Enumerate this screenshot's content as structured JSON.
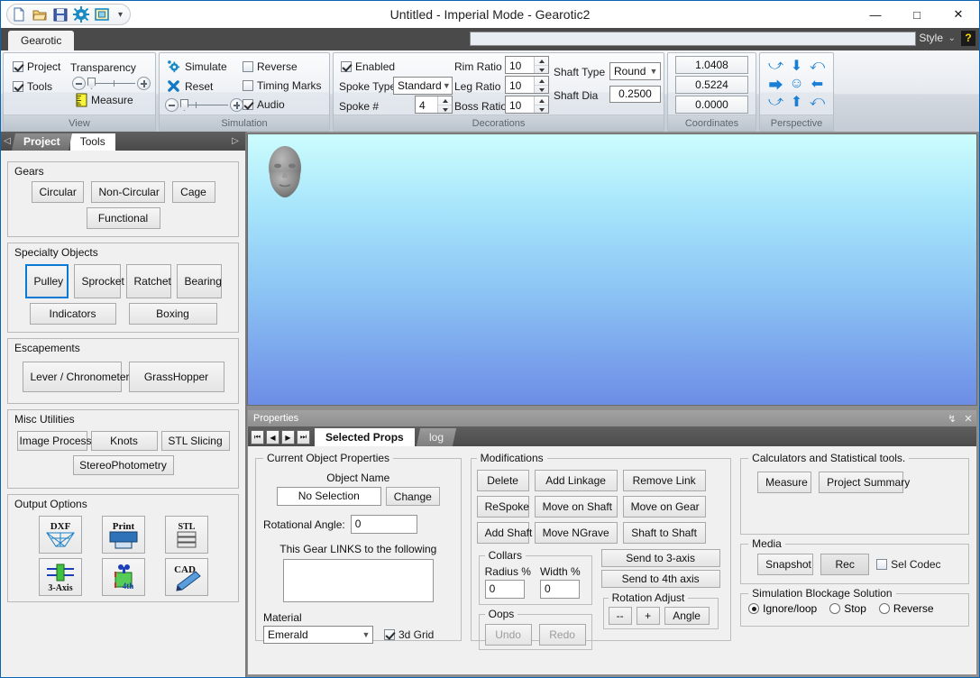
{
  "window": {
    "title": "Untitled -  Imperial Mode - Gearotic2",
    "minimize": "—",
    "maximize": "□",
    "close": "✕"
  },
  "quick_access": {
    "icons": [
      "new-document-icon",
      "open-folder-icon",
      "save-icon",
      "settings-gear-icon",
      "screen-capture-icon"
    ],
    "overflow": "▾"
  },
  "ribbon": {
    "tabs": [
      {
        "label": "Gearotic",
        "active": true
      }
    ],
    "search_placeholder": "",
    "style_label": "Style",
    "style_caret": "⌄",
    "help_label": "?",
    "groups": [
      {
        "name": "View",
        "label": "View",
        "checkboxes": [
          {
            "label": "Project",
            "checked": true
          },
          {
            "label": "Tools",
            "checked": true
          }
        ],
        "transparency_label": "Transparency",
        "measure_label": "Measure"
      },
      {
        "name": "Simulation",
        "label": "Simulation",
        "simulate_label": "Simulate",
        "reset_label": "Reset",
        "checkboxes": [
          {
            "label": "Reverse",
            "checked": false
          },
          {
            "label": "Timing Marks",
            "checked": false
          },
          {
            "label": "Audio",
            "checked": true
          }
        ]
      },
      {
        "name": "Decorations",
        "label": "Decorations",
        "enabled": {
          "label": "Enabled",
          "checked": true
        },
        "spoke_type": {
          "label": "Spoke Type",
          "value": "Standard"
        },
        "spoke_num": {
          "label": "Spoke #",
          "value": "4"
        },
        "rim_ratio": {
          "label": "Rim Ratio",
          "value": "10"
        },
        "leg_ratio": {
          "label": "Leg Ratio",
          "value": "10"
        },
        "boss_ratio": {
          "label": "Boss Ratio",
          "value": "10"
        },
        "shaft_type": {
          "label": "Shaft Type",
          "value": "Round"
        },
        "shaft_dia": {
          "label": "Shaft Dia",
          "value": "0.2500"
        }
      },
      {
        "name": "Coordinates",
        "label": "Coordinates",
        "values": [
          "1.0408",
          "0.5224",
          "0.0000"
        ]
      },
      {
        "name": "Perspective",
        "label": "Perspective",
        "buttons": [
          "rotate-cw-icon",
          "arrow-down-icon",
          "rotate-ccw-icon",
          "arrow-right-icon",
          "home-face-icon",
          "arrow-left-icon",
          "arrow-upright-icon",
          "arrow-up-icon",
          "undo-arrow-icon"
        ]
      }
    ]
  },
  "left_panel": {
    "tabs": [
      {
        "label": "Project",
        "active": false
      },
      {
        "label": "Tools",
        "active": true
      }
    ],
    "prev_arrow": "◁",
    "next_arrow": "▷",
    "sections": [
      {
        "title": "Gears",
        "rows": [
          [
            {
              "label": "Circular",
              "selected": false
            },
            {
              "label": "Non-Circular",
              "selected": false
            },
            {
              "label": "Cage",
              "selected": false
            }
          ],
          [
            {
              "label": "Functional",
              "selected": false
            }
          ]
        ]
      },
      {
        "title": "Specialty Objects",
        "rows": [
          [
            {
              "label": "Pulley",
              "selected": true
            },
            {
              "label": "Sprocket",
              "selected": false
            },
            {
              "label": "Ratchet",
              "selected": false
            },
            {
              "label": "Bearing",
              "selected": false
            }
          ],
          [
            {
              "label": "Indicators",
              "selected": false
            },
            {
              "label": "Boxing",
              "selected": false
            }
          ]
        ]
      },
      {
        "title": "Escapements",
        "rows": [
          [
            {
              "label": "Lever / Chronometer",
              "selected": false
            },
            {
              "label": "GrassHopper",
              "selected": false
            }
          ]
        ]
      },
      {
        "title": "Misc Utilities",
        "rows": [
          [
            {
              "label": "Image Process",
              "selected": false
            },
            {
              "label": "Knots",
              "selected": false
            },
            {
              "label": "STL Slicing",
              "selected": false
            }
          ],
          [
            {
              "label": "StereoPhotometry",
              "selected": false
            }
          ]
        ]
      }
    ],
    "output_options": {
      "title": "Output Options",
      "buttons": [
        {
          "label": "DXF",
          "icon": "dxf-export-icon"
        },
        {
          "label": "Print",
          "icon": "printer-icon"
        },
        {
          "label": "STL",
          "icon": "stl-export-icon"
        },
        {
          "label": "3-Axis",
          "icon": "three-axis-icon"
        },
        {
          "label": "4th",
          "icon": "fourth-axis-icon"
        },
        {
          "label": "CAD",
          "icon": "cad-pencil-icon"
        }
      ]
    }
  },
  "viewport": {
    "model": "3d-head-model",
    "background_top": "#ccfdfd",
    "background_bottom": "#6d8de6"
  },
  "properties": {
    "header_title": "Properties",
    "pin_icon": "↯",
    "close_icon": "✕",
    "nav_buttons": [
      "⏮",
      "◀",
      "▶",
      "⏭"
    ],
    "tabs": [
      {
        "label": "Selected Props",
        "active": true
      },
      {
        "label": "log",
        "active": false
      }
    ],
    "current_object": {
      "title": "Current Object Properties",
      "object_name_label": "Object Name",
      "object_name_value": "No Selection",
      "change_button": "Change",
      "rotational_angle_label": "Rotational Angle:",
      "rotational_angle_value": "0",
      "links_label": "This Gear LINKS to the following",
      "links_value": "",
      "material_label": "Material",
      "material_value": "Emerald",
      "grid_label": "3d Grid",
      "grid_checked": true
    },
    "modifications": {
      "title": "Modifications",
      "buttons": [
        "Delete",
        "Add Linkage",
        "Remove Link",
        "ReSpoke",
        "Move on Shaft",
        "Move on Gear",
        "Add Shaft",
        "Move NGrave",
        "Shaft to Shaft"
      ],
      "collars": {
        "title": "Collars",
        "radius_label": "Radius %",
        "radius_value": "0",
        "width_label": "Width %",
        "width_value": "0"
      },
      "oops": {
        "title": "Oops",
        "undo_label": "Undo",
        "redo_label": "Redo"
      },
      "send_3axis": "Send to 3-axis",
      "send_4axis": "Send to 4th axis",
      "rotation_adjust": {
        "title": "Rotation Adjust",
        "minus": "--",
        "plus": "+",
        "angle": "Angle"
      }
    },
    "calculators": {
      "title": "Calculators and Statistical tools.",
      "measure_button": "Measure",
      "summary_button": "Project Summary"
    },
    "media": {
      "title": "Media",
      "snapshot_button": "Snapshot",
      "rec_button": "Rec",
      "codec_label": "Sel Codec",
      "codec_checked": false
    },
    "blockage": {
      "title": "Simulation Blockage Solution",
      "options": [
        {
          "label": "Ignore/loop",
          "selected": true
        },
        {
          "label": "Stop",
          "selected": false
        },
        {
          "label": "Reverse",
          "selected": false
        }
      ]
    }
  }
}
